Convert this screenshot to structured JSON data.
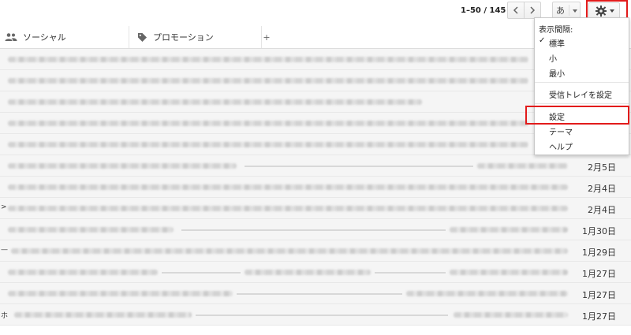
{
  "toolbar": {
    "pager": "1–50 / 145",
    "ime_label": "あ",
    "accent_red": "#e21b1b"
  },
  "tabs": [
    {
      "label": "ソーシャル",
      "icon": "people-icon"
    },
    {
      "label": "プロモーション",
      "icon": "tag-icon"
    },
    {
      "label": "+"
    }
  ],
  "messages": [
    {
      "date": ""
    },
    {
      "date": ""
    },
    {
      "date": ""
    },
    {
      "date": ""
    },
    {
      "date": ""
    },
    {
      "date": "2月5日"
    },
    {
      "date": "2月4日"
    },
    {
      "date": "2月4日",
      "marker": ">"
    },
    {
      "date": "1月30日"
    },
    {
      "date": "1月29日",
      "marker": "—"
    },
    {
      "date": "1月27日"
    },
    {
      "date": "1月27日"
    },
    {
      "date": "1月27日",
      "marker": "ホ"
    }
  ],
  "menu": {
    "density_header": "表示間隔:",
    "density_standard": "標準",
    "density_small": "小",
    "density_smallest": "最小",
    "inbox_settings": "受信トレイを設定",
    "settings": "設定",
    "themes": "テーマ",
    "help": "ヘルプ"
  }
}
